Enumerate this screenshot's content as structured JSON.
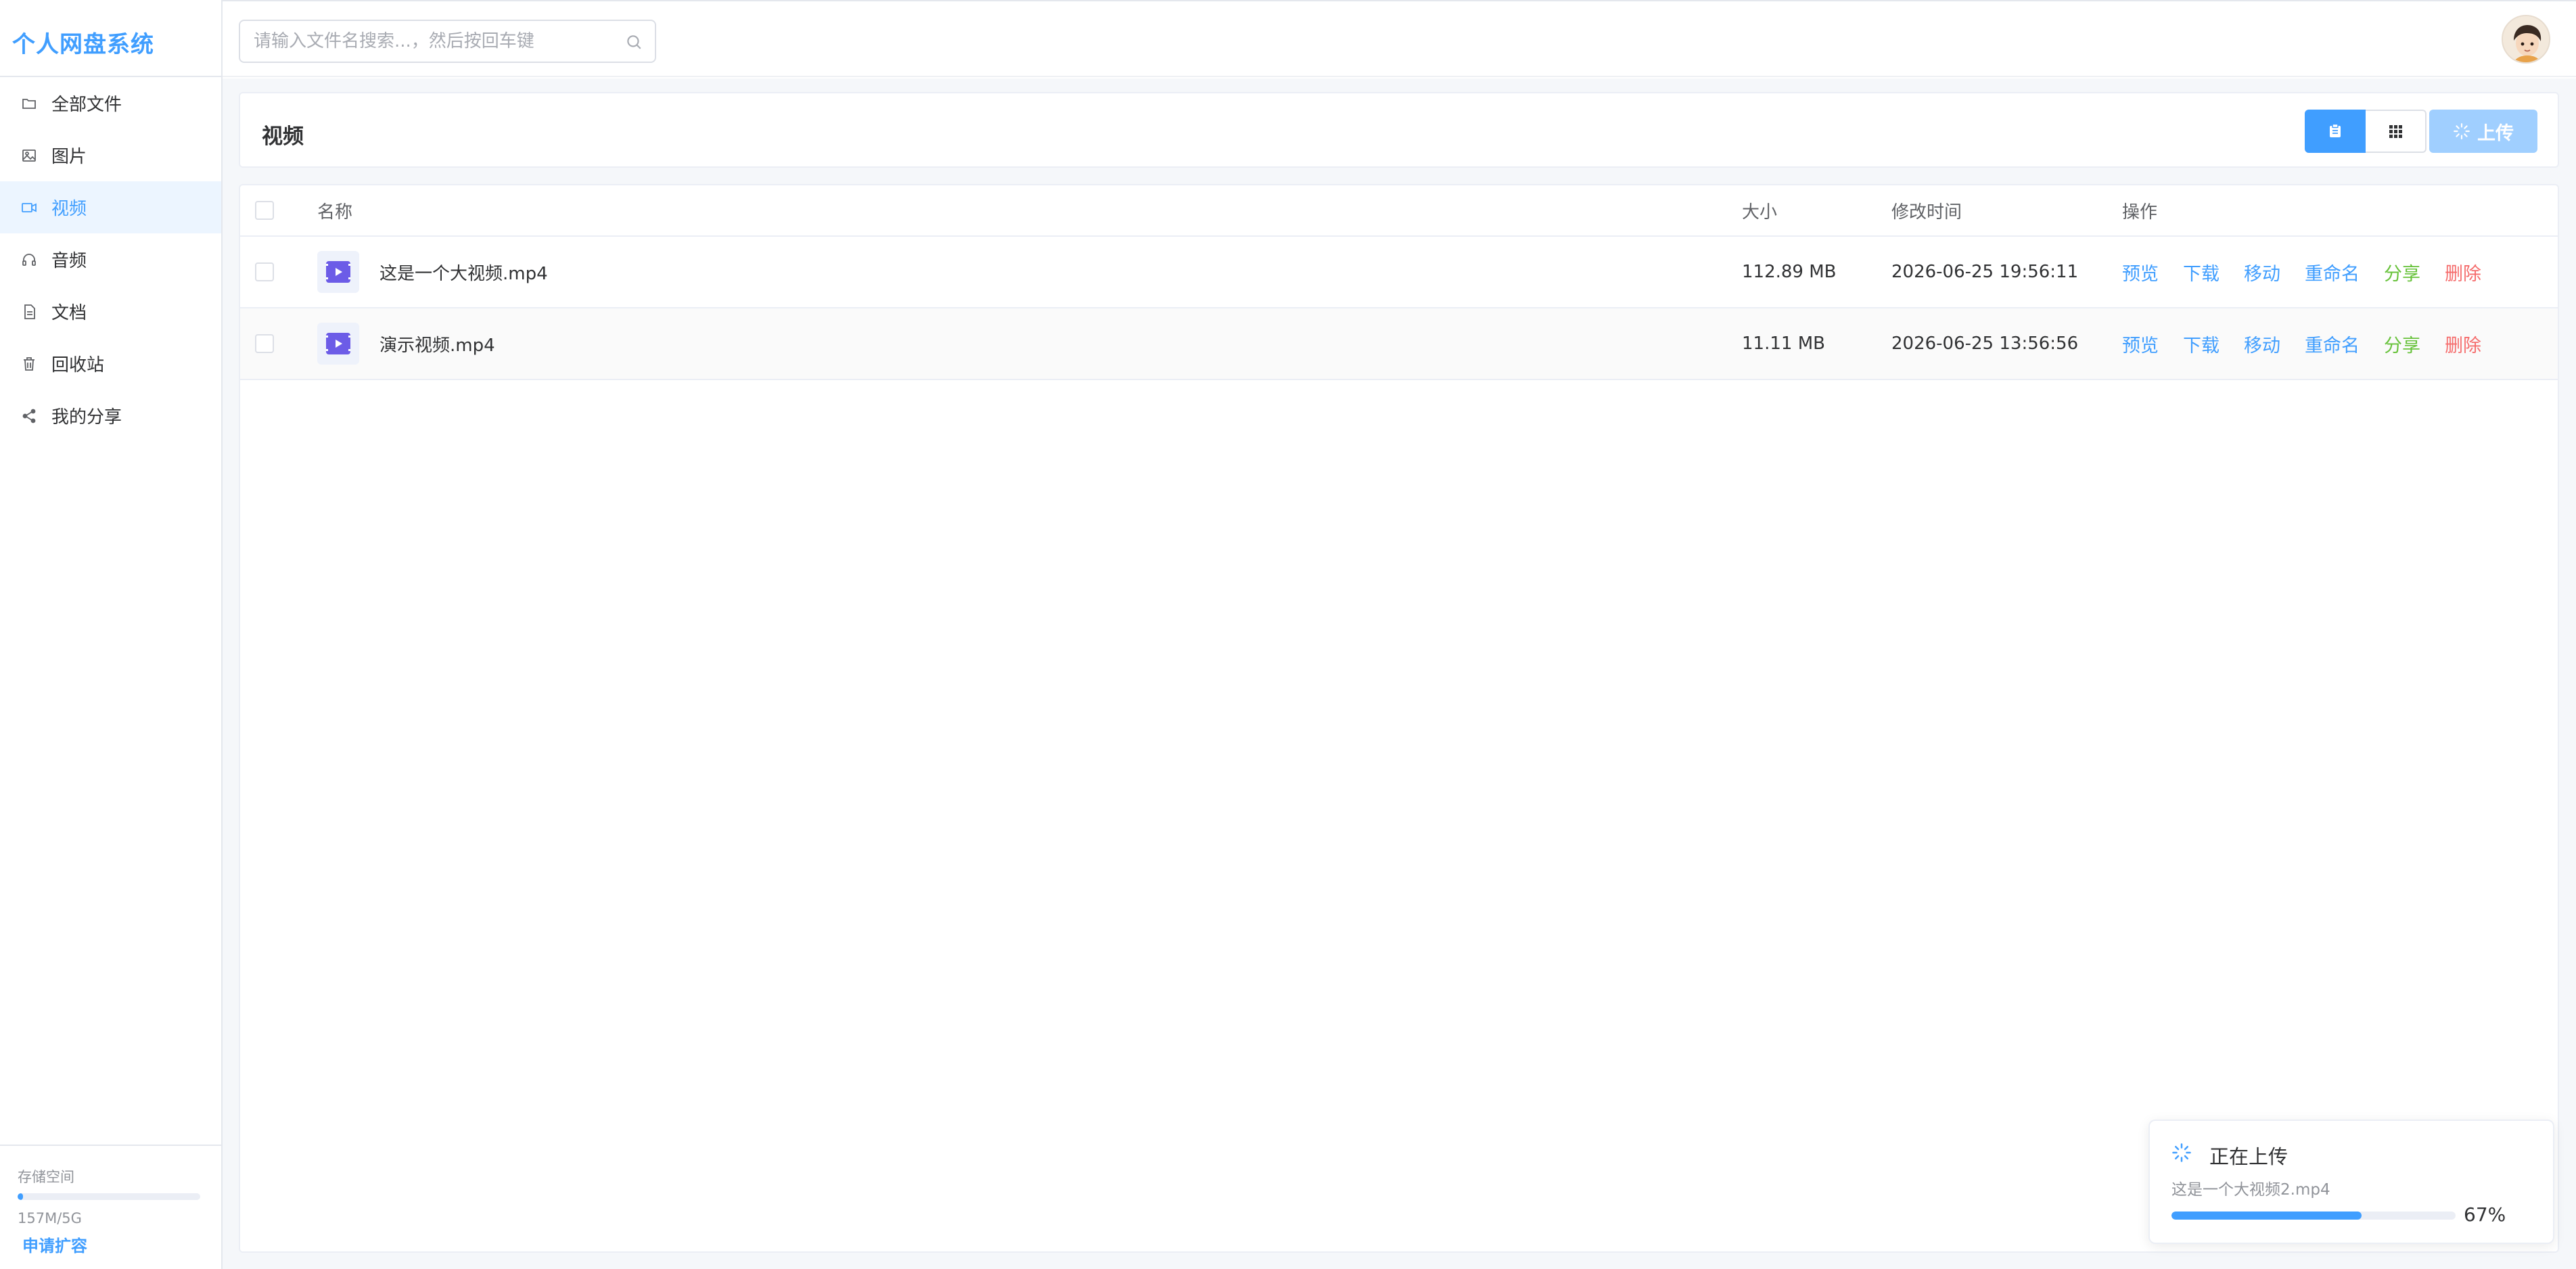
{
  "app": {
    "title": "个人网盘系统"
  },
  "sidebar": {
    "items": [
      {
        "label": "全部文件",
        "icon": "folder-icon",
        "active": false
      },
      {
        "label": "图片",
        "icon": "image-icon",
        "active": false
      },
      {
        "label": "视频",
        "icon": "video-icon",
        "active": true
      },
      {
        "label": "音频",
        "icon": "headphones-icon",
        "active": false
      },
      {
        "label": "文档",
        "icon": "document-icon",
        "active": false
      },
      {
        "label": "回收站",
        "icon": "trash-icon",
        "active": false
      },
      {
        "label": "我的分享",
        "icon": "share-icon",
        "active": false
      }
    ],
    "storage": {
      "label": "存储空间",
      "used_text": "157M/5G",
      "used_fraction": 0.03,
      "apply_label": "申请扩容"
    }
  },
  "header": {
    "search": {
      "placeholder": "请输入文件名搜索...，然后按回车键",
      "value": ""
    },
    "avatar_icon": "user-avatar"
  },
  "main": {
    "page_title": "视频",
    "view_toggle": {
      "list_icon": "list-view-icon",
      "grid_icon": "grid-view-icon",
      "active": "list"
    },
    "upload_label": "上传",
    "table": {
      "columns": [
        "名称",
        "大小",
        "修改时间",
        "操作"
      ],
      "rows": [
        {
          "name": "这是一个大视频.mp4",
          "size": "112.89 MB",
          "modified": "2026-06-25 19:56:11"
        },
        {
          "name": "演示视频.mp4",
          "size": "11.11 MB",
          "modified": "2026-06-25 13:56:56"
        }
      ],
      "actions": [
        "预览",
        "下载",
        "移动",
        "重命名",
        "分享",
        "删除"
      ]
    }
  },
  "upload_toast": {
    "title": "正在上传",
    "filename": "这是一个大视频2.mp4",
    "progress_text": "67%",
    "progress_fraction": 0.67
  },
  "colors": {
    "accent": "#409eff",
    "active_bg": "#ecf5ff",
    "share": "#67c23a",
    "delete": "#f56c6c",
    "video_icon": "#6c5ce7"
  }
}
